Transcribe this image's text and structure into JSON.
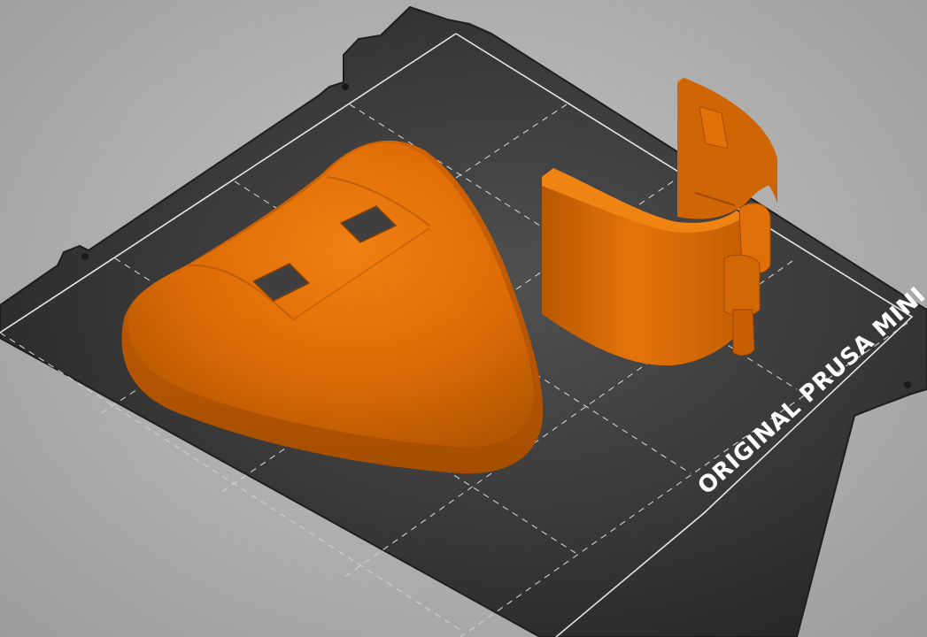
{
  "viewport": {
    "bed_label": "ORIGINAL PRUSA MINI"
  },
  "colors": {
    "background": "#b4b4b4",
    "bed_plate": "#2f2f2f",
    "bed_border": "#242424",
    "grid_line": "#d8d8d8",
    "model_orange": "#d96a06",
    "model_highlight": "#ef7d12",
    "model_shadow": "#a94f02"
  },
  "icons": {
    "bed": "print-bed-plate",
    "model_1": "rounded-triangle-shell-model",
    "model_2": "hinge-clip-model"
  }
}
